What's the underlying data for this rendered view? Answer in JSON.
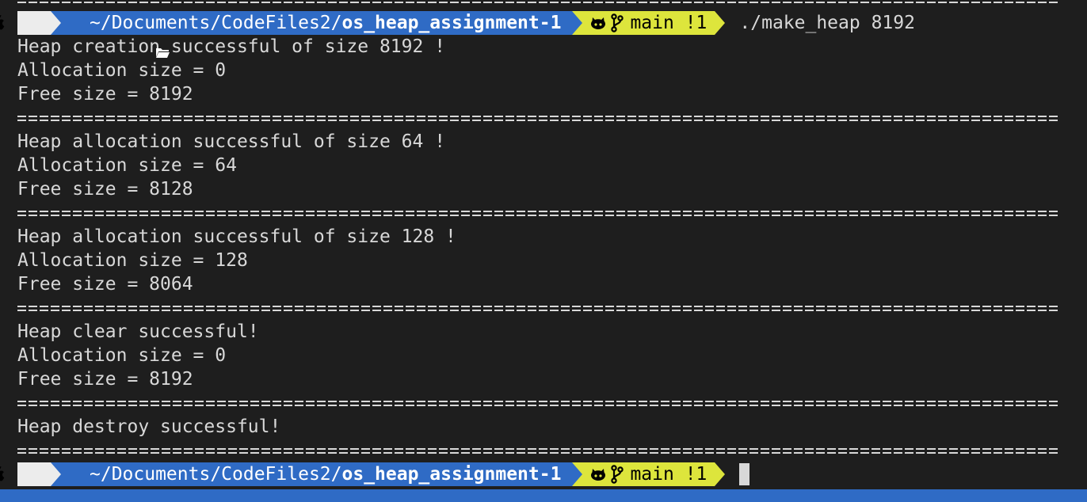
{
  "prompts": [
    {
      "dir_prefix": "~/Documents/CodeFiles2/",
      "dir_repo": "os_heap_assignment-1",
      "branch": "main",
      "status": "!1",
      "command": "./make_heap 8192"
    },
    {
      "dir_prefix": "~/Documents/CodeFiles2/",
      "dir_repo": "os_heap_assignment-1",
      "branch": "main",
      "status": "!1",
      "command": ""
    }
  ],
  "output": {
    "block1": [
      "Heap creation successful of size 8192 !",
      "Allocation size = 0",
      "Free size = 8192"
    ],
    "block2": [
      "Heap allocation successful of size 64 !",
      "Allocation size = 64",
      "Free size = 8128"
    ],
    "block3": [
      "Heap allocation successful of size 128 !",
      "Allocation size = 128",
      "Free size = 8064"
    ],
    "block4": [
      "Heap clear successful!",
      "Allocation size = 0",
      "Free size = 8192"
    ],
    "block5": [
      "Heap destroy successful!"
    ]
  },
  "icons": {
    "os": "apple-icon",
    "folder": "folder-icon",
    "git_host": "github-icon",
    "branch": "git-branch-icon"
  },
  "colors": {
    "background": "#1e1e1e",
    "text": "#d8d8d8",
    "os_segment": "#ececec",
    "dir_segment": "#2f6bc5",
    "git_segment": "#dde53c"
  }
}
